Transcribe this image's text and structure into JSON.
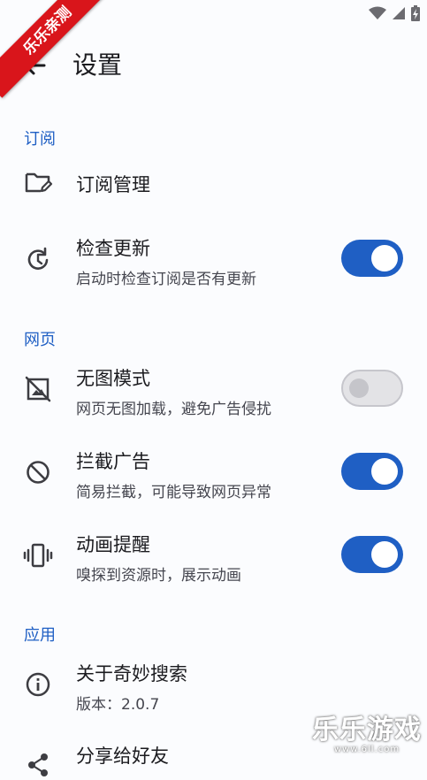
{
  "status": {
    "wifi_icon": "wifi-icon",
    "signal_icon": "signal-icon",
    "battery_icon": "battery-charging-icon"
  },
  "header": {
    "title": "设置",
    "back_icon": "arrow-back-icon"
  },
  "sections": {
    "subscribe": "订阅",
    "web": "网页",
    "app": "应用"
  },
  "rows": {
    "manage": {
      "title": "订阅管理"
    },
    "check_update": {
      "title": "检查更新",
      "subtitle": "启动时检查订阅是否有更新",
      "enabled": true
    },
    "no_image": {
      "title": "无图模式",
      "subtitle": "网页无图加载，避免广告侵扰",
      "enabled": false
    },
    "block_ads": {
      "title": "拦截广告",
      "subtitle": "简易拦截，可能导致网页异常",
      "enabled": true
    },
    "animation": {
      "title": "动画提醒",
      "subtitle": "嗅探到资源时，展示动画",
      "enabled": true
    },
    "about": {
      "title": "关于奇妙搜索",
      "subtitle": "版本：2.0.7"
    },
    "share": {
      "title": "分享给好友"
    }
  },
  "colors": {
    "accent": "#1f5fc4",
    "toggle_off": "#e3e3e6"
  },
  "overlay": {
    "ribbon": "乐乐亲测",
    "watermark_main": "乐乐游戏",
    "watermark_url": "www.6ll.com"
  }
}
